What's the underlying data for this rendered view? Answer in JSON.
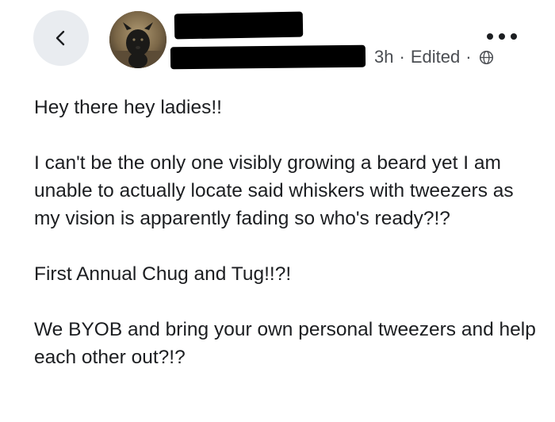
{
  "header": {
    "back_icon": "chevron-left-icon",
    "avatar_alt": "profile photo",
    "timestamp": "3h",
    "separator": "·",
    "edited_label": "Edited",
    "audience_icon": "globe-icon",
    "more_icon": "ellipsis-icon",
    "colors": {
      "back_bg": "#e9ecf0",
      "meta_text": "#4a4d52",
      "body_text": "#1c1e21"
    }
  },
  "post": {
    "paragraphs": [
      "Hey there hey ladies!!",
      "I can't be the only one visibly growing a beard yet I am unable to actually locate said whiskers with tweezers as my vision is apparently fading so who's ready?!?",
      "First Annual Chug and Tug!!?!",
      "We BYOB and bring your own personal tweezers and help each other out?!?"
    ]
  }
}
